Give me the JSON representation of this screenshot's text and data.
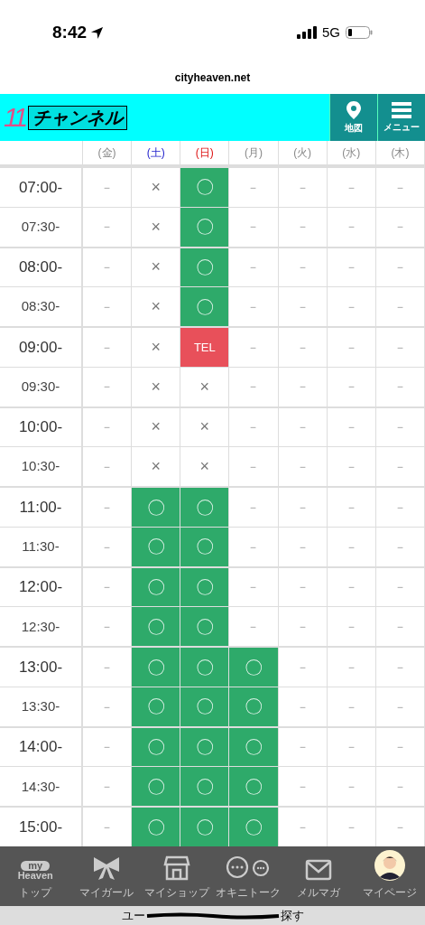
{
  "status_bar": {
    "time": "8:42",
    "network": "5G"
  },
  "url": "cityheaven.net",
  "header": {
    "logo_number": "11",
    "logo_text": "チャンネル",
    "buttons": [
      {
        "kind": "map",
        "label": "地図"
      },
      {
        "kind": "menu",
        "label": "メニュー"
      }
    ]
  },
  "schedule": {
    "days": [
      {
        "label": "(金)",
        "kind": "weekday"
      },
      {
        "label": "(土)",
        "kind": "saturday"
      },
      {
        "label": "(日)",
        "kind": "sunday"
      },
      {
        "label": "(月)",
        "kind": "weekday"
      },
      {
        "label": "(火)",
        "kind": "weekday"
      },
      {
        "label": "(水)",
        "kind": "weekday"
      },
      {
        "label": "(木)",
        "kind": "weekday"
      }
    ],
    "rows": [
      {
        "time": "07:00-",
        "major": true,
        "cells": [
          {
            "kind": "none",
            "text": "－"
          },
          {
            "kind": "full",
            "text": "×"
          },
          {
            "kind": "open",
            "text": "〇"
          },
          {
            "kind": "none",
            "text": "－"
          },
          {
            "kind": "none",
            "text": "－"
          },
          {
            "kind": "none",
            "text": "－"
          },
          {
            "kind": "none",
            "text": "－"
          }
        ]
      },
      {
        "time": "07:30-",
        "major": false,
        "cells": [
          {
            "kind": "none",
            "text": "－"
          },
          {
            "kind": "full",
            "text": "×"
          },
          {
            "kind": "open",
            "text": "〇"
          },
          {
            "kind": "none",
            "text": "－"
          },
          {
            "kind": "none",
            "text": "－"
          },
          {
            "kind": "none",
            "text": "－"
          },
          {
            "kind": "none",
            "text": "－"
          }
        ]
      },
      {
        "time": "08:00-",
        "major": true,
        "cells": [
          {
            "kind": "none",
            "text": "－"
          },
          {
            "kind": "full",
            "text": "×"
          },
          {
            "kind": "open",
            "text": "〇"
          },
          {
            "kind": "none",
            "text": "－"
          },
          {
            "kind": "none",
            "text": "－"
          },
          {
            "kind": "none",
            "text": "－"
          },
          {
            "kind": "none",
            "text": "－"
          }
        ]
      },
      {
        "time": "08:30-",
        "major": false,
        "cells": [
          {
            "kind": "none",
            "text": "－"
          },
          {
            "kind": "full",
            "text": "×"
          },
          {
            "kind": "open",
            "text": "〇"
          },
          {
            "kind": "none",
            "text": "－"
          },
          {
            "kind": "none",
            "text": "－"
          },
          {
            "kind": "none",
            "text": "－"
          },
          {
            "kind": "none",
            "text": "－"
          }
        ]
      },
      {
        "time": "09:00-",
        "major": true,
        "cells": [
          {
            "kind": "none",
            "text": "－"
          },
          {
            "kind": "full",
            "text": "×"
          },
          {
            "kind": "tel",
            "text": "TEL"
          },
          {
            "kind": "none",
            "text": "－"
          },
          {
            "kind": "none",
            "text": "－"
          },
          {
            "kind": "none",
            "text": "－"
          },
          {
            "kind": "none",
            "text": "－"
          }
        ]
      },
      {
        "time": "09:30-",
        "major": false,
        "cells": [
          {
            "kind": "none",
            "text": "－"
          },
          {
            "kind": "full",
            "text": "×"
          },
          {
            "kind": "full",
            "text": "×"
          },
          {
            "kind": "none",
            "text": "－"
          },
          {
            "kind": "none",
            "text": "－"
          },
          {
            "kind": "none",
            "text": "－"
          },
          {
            "kind": "none",
            "text": "－"
          }
        ]
      },
      {
        "time": "10:00-",
        "major": true,
        "cells": [
          {
            "kind": "none",
            "text": "－"
          },
          {
            "kind": "full",
            "text": "×"
          },
          {
            "kind": "full",
            "text": "×"
          },
          {
            "kind": "none",
            "text": "－"
          },
          {
            "kind": "none",
            "text": "－"
          },
          {
            "kind": "none",
            "text": "－"
          },
          {
            "kind": "none",
            "text": "－"
          }
        ]
      },
      {
        "time": "10:30-",
        "major": false,
        "cells": [
          {
            "kind": "none",
            "text": "－"
          },
          {
            "kind": "full",
            "text": "×"
          },
          {
            "kind": "full",
            "text": "×"
          },
          {
            "kind": "none",
            "text": "－"
          },
          {
            "kind": "none",
            "text": "－"
          },
          {
            "kind": "none",
            "text": "－"
          },
          {
            "kind": "none",
            "text": "－"
          }
        ]
      },
      {
        "time": "11:00-",
        "major": true,
        "cells": [
          {
            "kind": "none",
            "text": "－"
          },
          {
            "kind": "open",
            "text": "〇"
          },
          {
            "kind": "open",
            "text": "〇"
          },
          {
            "kind": "none",
            "text": "－"
          },
          {
            "kind": "none",
            "text": "－"
          },
          {
            "kind": "none",
            "text": "－"
          },
          {
            "kind": "none",
            "text": "－"
          }
        ]
      },
      {
        "time": "11:30-",
        "major": false,
        "cells": [
          {
            "kind": "none",
            "text": "－"
          },
          {
            "kind": "open",
            "text": "〇"
          },
          {
            "kind": "open",
            "text": "〇"
          },
          {
            "kind": "none",
            "text": "－"
          },
          {
            "kind": "none",
            "text": "－"
          },
          {
            "kind": "none",
            "text": "－"
          },
          {
            "kind": "none",
            "text": "－"
          }
        ]
      },
      {
        "time": "12:00-",
        "major": true,
        "cells": [
          {
            "kind": "none",
            "text": "－"
          },
          {
            "kind": "open",
            "text": "〇"
          },
          {
            "kind": "open",
            "text": "〇"
          },
          {
            "kind": "none",
            "text": "－"
          },
          {
            "kind": "none",
            "text": "－"
          },
          {
            "kind": "none",
            "text": "－"
          },
          {
            "kind": "none",
            "text": "－"
          }
        ]
      },
      {
        "time": "12:30-",
        "major": false,
        "cells": [
          {
            "kind": "none",
            "text": "－"
          },
          {
            "kind": "open",
            "text": "〇"
          },
          {
            "kind": "open",
            "text": "〇"
          },
          {
            "kind": "none",
            "text": "－"
          },
          {
            "kind": "none",
            "text": "－"
          },
          {
            "kind": "none",
            "text": "－"
          },
          {
            "kind": "none",
            "text": "－"
          }
        ]
      },
      {
        "time": "13:00-",
        "major": true,
        "cells": [
          {
            "kind": "none",
            "text": "－"
          },
          {
            "kind": "open",
            "text": "〇"
          },
          {
            "kind": "open",
            "text": "〇"
          },
          {
            "kind": "open",
            "text": "〇"
          },
          {
            "kind": "none",
            "text": "－"
          },
          {
            "kind": "none",
            "text": "－"
          },
          {
            "kind": "none",
            "text": "－"
          }
        ]
      },
      {
        "time": "13:30-",
        "major": false,
        "cells": [
          {
            "kind": "none",
            "text": "－"
          },
          {
            "kind": "open",
            "text": "〇"
          },
          {
            "kind": "open",
            "text": "〇"
          },
          {
            "kind": "open",
            "text": "〇"
          },
          {
            "kind": "none",
            "text": "－"
          },
          {
            "kind": "none",
            "text": "－"
          },
          {
            "kind": "none",
            "text": "－"
          }
        ]
      },
      {
        "time": "14:00-",
        "major": true,
        "cells": [
          {
            "kind": "none",
            "text": "－"
          },
          {
            "kind": "open",
            "text": "〇"
          },
          {
            "kind": "open",
            "text": "〇"
          },
          {
            "kind": "open",
            "text": "〇"
          },
          {
            "kind": "none",
            "text": "－"
          },
          {
            "kind": "none",
            "text": "－"
          },
          {
            "kind": "none",
            "text": "－"
          }
        ]
      },
      {
        "time": "14:30-",
        "major": false,
        "cells": [
          {
            "kind": "none",
            "text": "－"
          },
          {
            "kind": "open",
            "text": "〇"
          },
          {
            "kind": "open",
            "text": "〇"
          },
          {
            "kind": "open",
            "text": "〇"
          },
          {
            "kind": "none",
            "text": "－"
          },
          {
            "kind": "none",
            "text": "－"
          },
          {
            "kind": "none",
            "text": "－"
          }
        ]
      },
      {
        "time": "15:00-",
        "major": true,
        "cells": [
          {
            "kind": "none",
            "text": "－"
          },
          {
            "kind": "open",
            "text": "〇"
          },
          {
            "kind": "open",
            "text": "〇"
          },
          {
            "kind": "open",
            "text": "〇"
          },
          {
            "kind": "none",
            "text": "－"
          },
          {
            "kind": "none",
            "text": "－"
          },
          {
            "kind": "none",
            "text": "－"
          }
        ]
      }
    ]
  },
  "bottom_nav": [
    {
      "kind": "myheaven",
      "label": "トップ",
      "icon_top": "my",
      "icon_bottom": "Heaven"
    },
    {
      "kind": "ribbon",
      "label": "マイガール"
    },
    {
      "kind": "shop",
      "label": "マイショップ"
    },
    {
      "kind": "chat",
      "label": "オキニトーク"
    },
    {
      "kind": "mail",
      "label": "メルマガ"
    },
    {
      "kind": "avatar",
      "label": "マイページ"
    }
  ],
  "banner": {
    "start": "ユー",
    "end": "探す"
  }
}
